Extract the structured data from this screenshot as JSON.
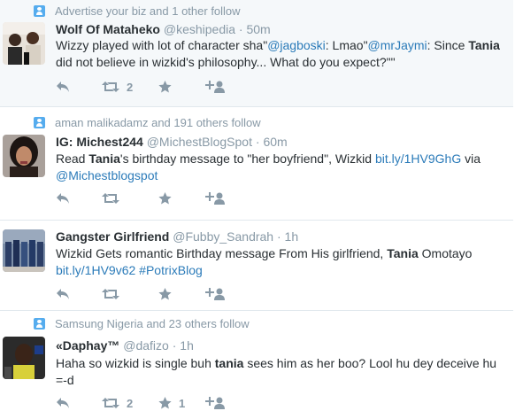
{
  "tweets": [
    {
      "context": "Advertise your biz and 1 other follow",
      "fullname": "Wolf Of Mataheko",
      "handle": "@keshipedia",
      "dot": "·",
      "time": "50m",
      "text": [
        {
          "t": "Wizzy played with lot of character sha\""
        },
        {
          "t": "@jagboski",
          "link": true
        },
        {
          "t": ": Lmao\""
        },
        {
          "t": "@mrJaymi",
          "link": true
        },
        {
          "t": ": Since "
        },
        {
          "t": "Tania",
          "bold": true
        },
        {
          "t": " did not believe in wizkid's philosophy... What do you expect?\"\""
        }
      ],
      "retweet_count": "2",
      "like_count": "",
      "highlight": true
    },
    {
      "context": "aman malikadamz and 191 others follow",
      "fullname": "IG: Michest244",
      "handle": "@MichestBlogSpot",
      "dot": "·",
      "time": "60m",
      "text": [
        {
          "t": "Read "
        },
        {
          "t": "Tania",
          "bold": true
        },
        {
          "t": "'s birthday message to \"her boyfriend\", Wizkid "
        },
        {
          "t": "bit.ly/1HV9GhG",
          "link": true
        },
        {
          "t": " via "
        },
        {
          "t": "@Michestblogspot",
          "link": true
        }
      ],
      "retweet_count": "",
      "like_count": "",
      "highlight": false
    },
    {
      "context": "",
      "fullname": "Gangster Girlfriend",
      "handle": "@Fubby_Sandrah",
      "dot": "·",
      "time": "1h",
      "text": [
        {
          "t": "Wizkid Gets romantic Birthday message From His girlfriend, "
        },
        {
          "t": "Tania",
          "bold": true
        },
        {
          "t": " Omotayo "
        },
        {
          "t": "bit.ly/1HV9v62",
          "link": true
        },
        {
          "t": " "
        },
        {
          "t": "#PotrixBlog",
          "link": true
        }
      ],
      "retweet_count": "",
      "like_count": "",
      "highlight": false
    },
    {
      "context": "Samsung Nigeria and 23 others follow",
      "fullname": "«Daphay™",
      "handle": "@dafizo",
      "dot": "·",
      "time": "1h",
      "text": [
        {
          "t": "Haha so wizkid is single buh "
        },
        {
          "t": "tania",
          "bold": true
        },
        {
          "t": " sees him as her boo? Lool hu dey deceive hu =-d"
        }
      ],
      "retweet_count": "2",
      "like_count": "1",
      "highlight": false
    }
  ],
  "colors": {
    "link": "#2b7bb9",
    "muted": "#8899a6",
    "text": "#292f33",
    "context_icon": "#55acee",
    "highlight_bg": "#f5f8fa",
    "divider": "#e1e8ed"
  },
  "icons": {
    "context": "person-follow-icon",
    "reply": "reply-icon",
    "retweet": "retweet-icon",
    "like": "star-icon",
    "follow": "follow-icon"
  }
}
